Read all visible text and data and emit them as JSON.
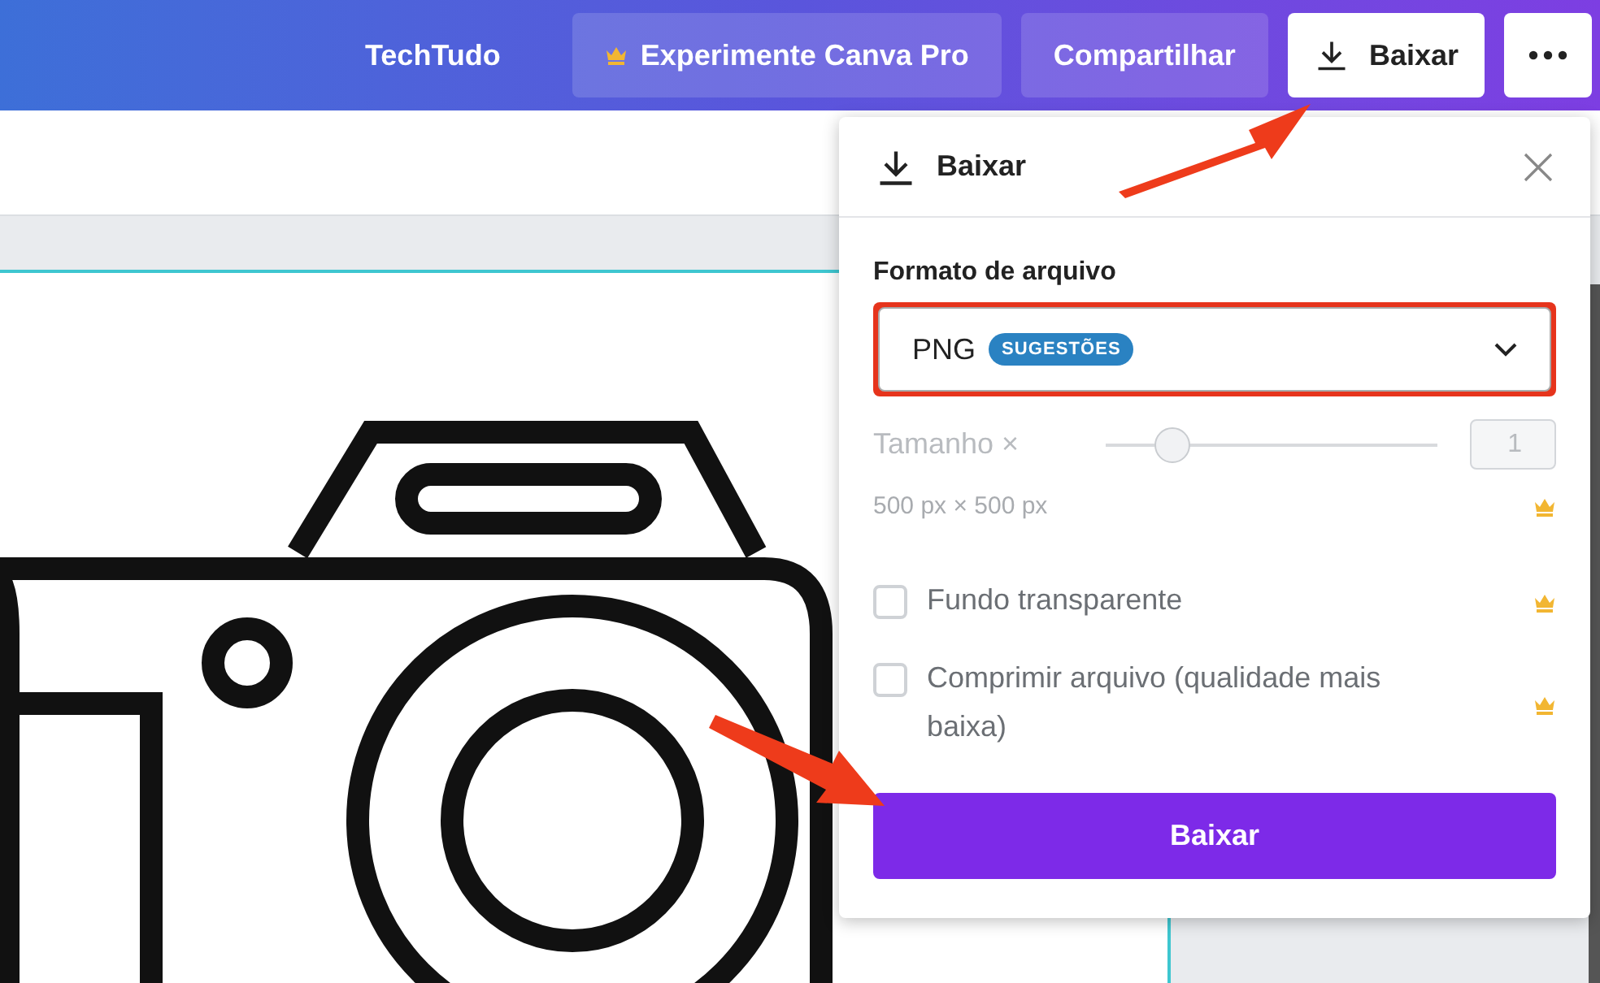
{
  "header": {
    "brand": "TechTudo",
    "buttons": [
      {
        "kind": "pro",
        "label": "Experimente Canva Pro"
      },
      {
        "kind": "plain",
        "label": "Compartilhar"
      },
      {
        "kind": "download",
        "label": "Baixar"
      },
      {
        "kind": "more"
      }
    ]
  },
  "download_panel": {
    "title": "Baixar",
    "format_label": "Formato de arquivo",
    "format": {
      "value": "PNG",
      "badge": "SUGESTÕES",
      "highlighted": true
    },
    "size": {
      "label": "Tamanho ×",
      "level": 0.2,
      "value": "1",
      "disabled": true
    },
    "dimensions": "500 px × 500 px",
    "options": [
      {
        "label": "Fundo transparente",
        "checked": false,
        "pro": true
      },
      {
        "label": "Comprimir arquivo (qualidade mais baixa)",
        "checked": false,
        "pro": true
      }
    ],
    "button": "Baixar"
  }
}
